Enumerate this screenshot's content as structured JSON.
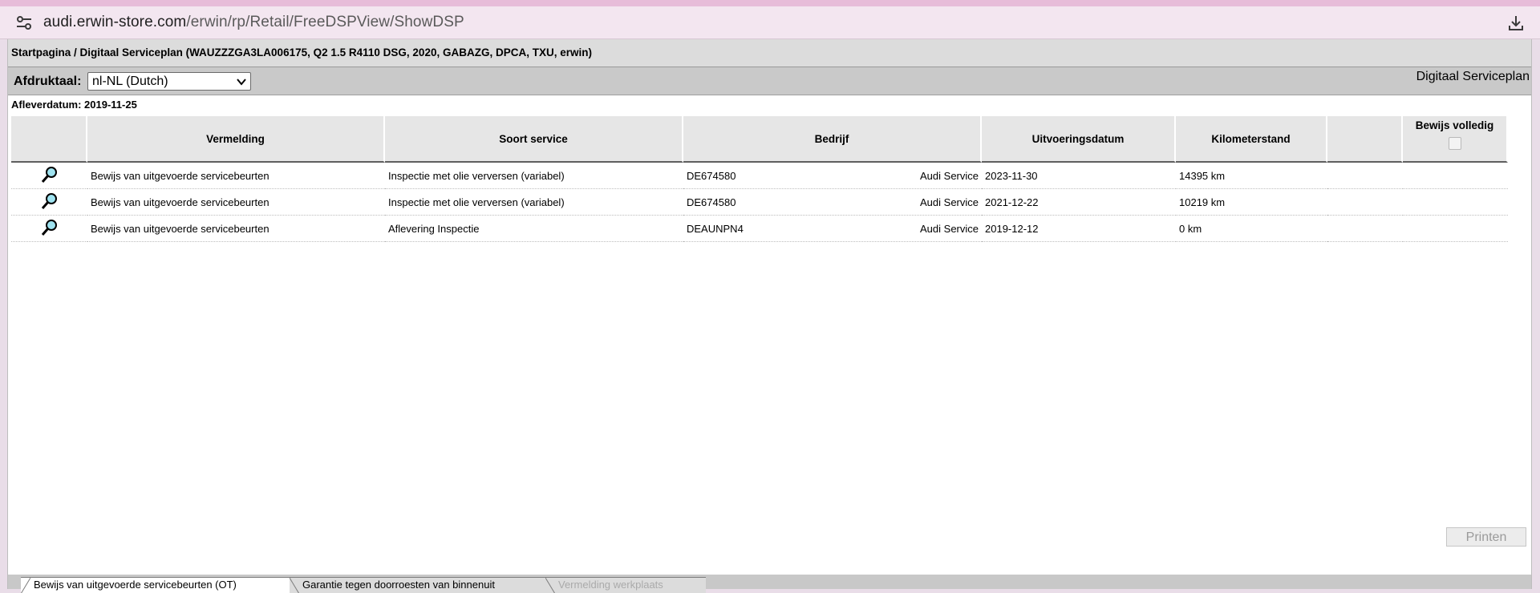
{
  "browser": {
    "url_host": "audi.erwin-store.com",
    "url_path": "/erwin/rp/Retail/FreeDSPView/ShowDSP"
  },
  "breadcrumb": "Startpagina / Digitaal Serviceplan (WAUZZZGA3LA006175, Q2 1.5 R4110 DSG, 2020, GABAZG, DPCA, TXU, erwin)",
  "toolbar": {
    "language_label": "Afdruktaal:",
    "language_value": "nl-NL (Dutch)",
    "app_title": "Digitaal Serviceplan"
  },
  "delivery": {
    "label": "Afleverdatum:",
    "date": "2019-11-25"
  },
  "table": {
    "headers": {
      "entry": "Vermelding",
      "service_type": "Soort service",
      "company": "Bedrijf",
      "date": "Uitvoeringsdatum",
      "mileage": "Kilometerstand",
      "extra": "",
      "proof_complete": "Bewijs volledig"
    },
    "rows": [
      {
        "entry": "Bewijs van uitgevoerde servicebeurten",
        "service_type": "Inspectie met olie verversen (variabel)",
        "company_code": "DE674580",
        "company_name": "Audi Service",
        "date": "2023-11-30",
        "mileage": "14395 km"
      },
      {
        "entry": "Bewijs van uitgevoerde servicebeurten",
        "service_type": "Inspectie met olie verversen (variabel)",
        "company_code": "DE674580",
        "company_name": "Audi Service",
        "date": "2021-12-22",
        "mileage": "10219 km"
      },
      {
        "entry": "Bewijs van uitgevoerde servicebeurten",
        "service_type": "Aflevering Inspectie",
        "company_code": "DEAUNPN4",
        "company_name": "Audi Service",
        "date": "2019-12-12",
        "mileage": "0 km"
      }
    ]
  },
  "print_label": "Printen",
  "tabs": [
    {
      "label": "Bewijs van uitgevoerde servicebeurten (OT)"
    },
    {
      "label": "Garantie tegen doorroesten van binnenuit"
    },
    {
      "label": "Vermelding werkplaats"
    }
  ]
}
